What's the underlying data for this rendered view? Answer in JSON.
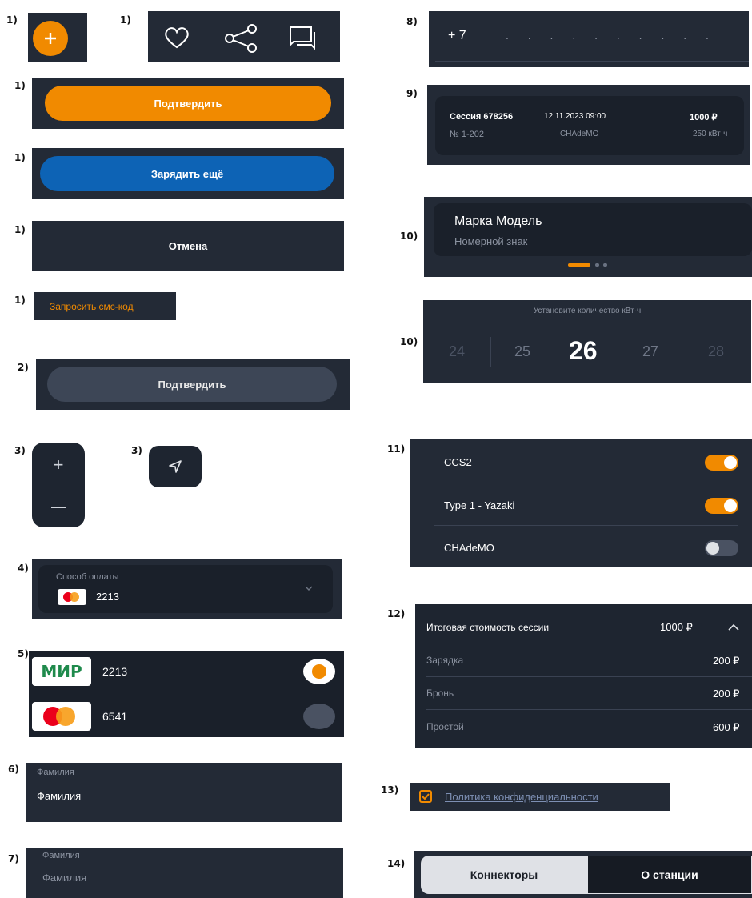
{
  "labels": {
    "n1a": "1)",
    "n1b": "1)",
    "n1c": "1)",
    "n1d": "1)",
    "n1e": "1)",
    "n1f": "1)",
    "n2": "2)",
    "n3a": "3)",
    "n3b": "3)",
    "n4": "4)",
    "n5": "5)",
    "n6": "6)",
    "n7": "7)",
    "n8": "8)",
    "n9": "9)",
    "n10a": "10)",
    "n10b": "10)",
    "n11": "11)",
    "n12": "12)",
    "n13": "13)",
    "n14": "14)"
  },
  "buttons": {
    "confirm": "Подтвердить",
    "charge_more": "Зарядить ещё",
    "cancel": "Отмена",
    "request_sms": "Запросить смс-код",
    "confirm_disabled": "Подтвердить"
  },
  "zoom": {
    "plus": "+",
    "minus": "—"
  },
  "payment": {
    "label": "Способ оплаты",
    "card": "2213"
  },
  "cards": [
    {
      "brand": "МИР",
      "number": "2213",
      "selected": true
    },
    {
      "brand": "mastercard",
      "number": "6541",
      "selected": false
    }
  ],
  "fields": {
    "surname_label": "Фамилия",
    "surname_value": "Фамилия",
    "surname_label2": "Фамилия",
    "surname_value2": "Фамилия"
  },
  "phone": {
    "prefix": "+ 7",
    "placeholder": ". . . . . . . . . ."
  },
  "session": {
    "title": "Сессия 678256",
    "datetime": "12.11.2023 09:00",
    "price": "1000 ₽",
    "number": "№ 1-202",
    "connector": "CHAdeMO",
    "energy": "250 кВт·ч"
  },
  "car": {
    "model": "Марка Модель",
    "plate": "Номерной знак"
  },
  "picker": {
    "title": "Установите количество кВт·ч",
    "values": [
      "24",
      "25",
      "26",
      "27",
      "28"
    ],
    "selected": "26"
  },
  "connectors": [
    {
      "name": "CCS2",
      "on": true
    },
    {
      "name": "Type 1 - Yazaki",
      "on": true
    },
    {
      "name": "CHAdeMO",
      "on": false
    }
  ],
  "cost": {
    "total_label": "Итоговая стоимость сессии",
    "total": "1000 ₽",
    "items": [
      {
        "label": "Зарядка",
        "value": "200 ₽"
      },
      {
        "label": "Бронь",
        "value": "200 ₽"
      },
      {
        "label": "Простой",
        "value": "600 ₽"
      }
    ]
  },
  "privacy": {
    "label": "Политика конфиденциальности",
    "checked": true
  },
  "tabs": {
    "left": "Коннекторы",
    "right": "О станции"
  },
  "colors": {
    "orange": "#f18a00",
    "blue": "#0d63b5",
    "dark": "#232a36",
    "card": "#1a202a"
  }
}
